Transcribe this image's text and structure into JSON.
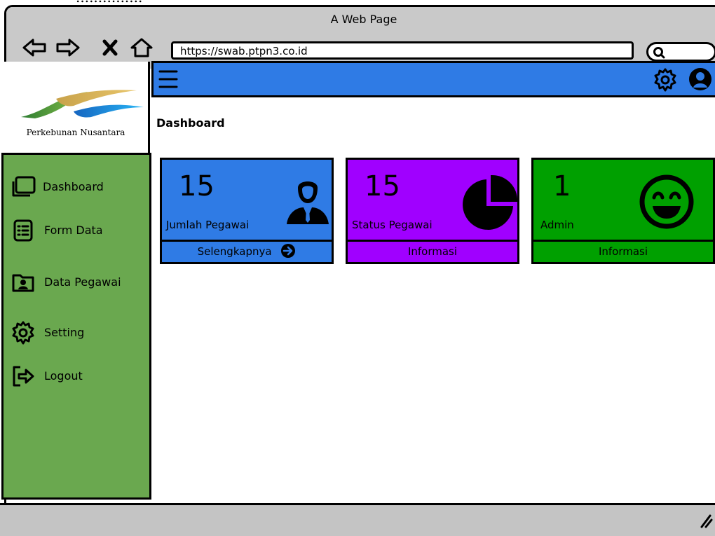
{
  "browser": {
    "window_title": "A Web Page",
    "url": "https://swab.ptpn3.co.id",
    "nav_icons": [
      "back-arrow-icon",
      "forward-arrow-icon",
      "close-x-icon",
      "home-icon"
    ],
    "search_icon": "search-icon"
  },
  "logo": {
    "text": "Perkebunan Nusantara"
  },
  "sidebar": {
    "items": [
      {
        "label": "Dashboard",
        "icon": "window-icon"
      },
      {
        "label": "Form Data",
        "icon": "list-icon"
      },
      {
        "label": "Data Pegawai",
        "icon": "user-folder-icon"
      },
      {
        "label": "Setting",
        "icon": "gear-icon"
      },
      {
        "label": "Logout",
        "icon": "logout-icon"
      }
    ]
  },
  "header": {
    "menu_icon": "hamburger-menu-icon",
    "settings_icon": "gear-icon",
    "user_icon": "user-avatar-icon"
  },
  "main": {
    "page_title": "Dashboard",
    "cards": [
      {
        "value": "15",
        "caption": "Jumlah Pegawai",
        "footer": "Selengkapnya",
        "icon": "employee-icon",
        "color": "#2f7be5"
      },
      {
        "value": "15",
        "caption": "Status Pegawai",
        "footer": "Informasi",
        "icon": "pie-chart-icon",
        "color": "#a000ff"
      },
      {
        "value": "1",
        "caption": "Admin",
        "footer": "Informasi",
        "icon": "smiley-icon",
        "color": "#00a000"
      }
    ]
  },
  "colors": {
    "sidebar_bg": "#6aa84f",
    "header_bg": "#2f7be5",
    "chrome_bg": "#c9c9c9"
  }
}
